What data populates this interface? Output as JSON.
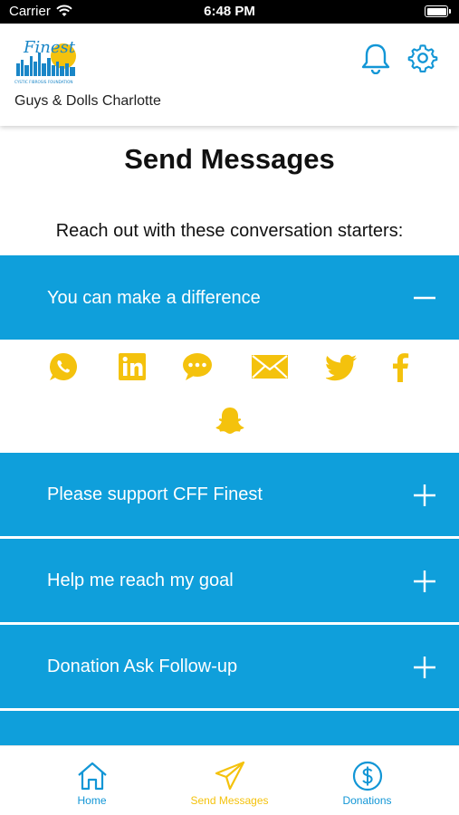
{
  "status_bar": {
    "carrier": "Carrier",
    "time": "6:48 PM"
  },
  "header": {
    "org_name": "Guys & Dolls Charlotte",
    "logo_text": "Finest",
    "logo_subtext": "CYSTIC FIBROSIS FOUNDATION"
  },
  "page": {
    "title": "Send Messages",
    "subtitle": "Reach out with these conversation starters:"
  },
  "messages": [
    {
      "label": "You can make a difference",
      "expanded": true
    },
    {
      "label": "Please support CFF Finest",
      "expanded": false
    },
    {
      "label": "Help me reach my goal",
      "expanded": false
    },
    {
      "label": "Donation Ask Follow-up",
      "expanded": false
    }
  ],
  "share_icons": [
    "whatsapp-icon",
    "linkedin-icon",
    "sms-icon",
    "email-icon",
    "twitter-icon",
    "facebook-icon",
    "snapchat-icon"
  ],
  "bottom_nav": {
    "home": "Home",
    "send_messages": "Send Messages",
    "donations": "Donations"
  },
  "colors": {
    "accent_blue": "#0f9fdb",
    "share_yellow": "#f4c20d",
    "nav_blue": "#1296d6"
  }
}
